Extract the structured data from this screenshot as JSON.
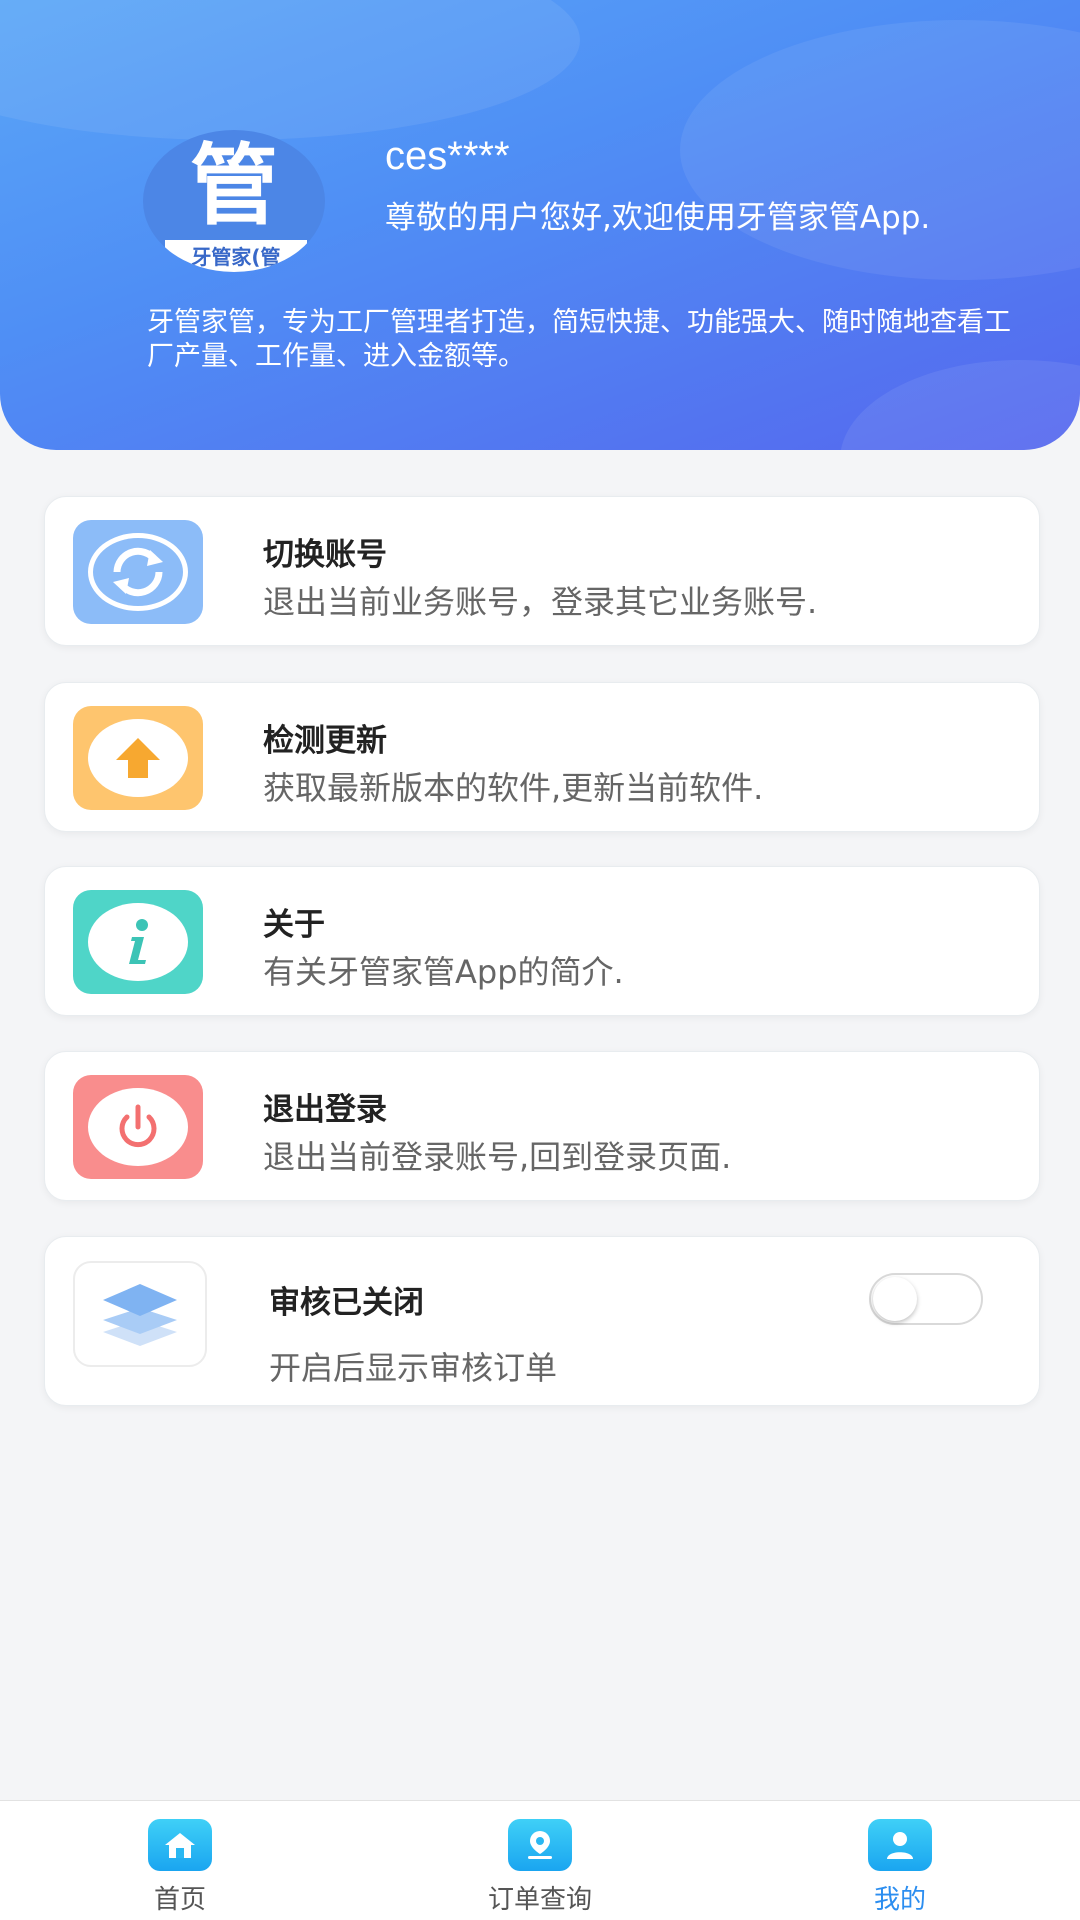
{
  "colors": {
    "header_start": "#5aa6f7",
    "header_end": "#5567ee",
    "switch_icon": "#8cbcf8",
    "update_icon": "#fec56e",
    "about_icon": "#4fd5c8",
    "logout_icon": "#f98d8d",
    "tab_active": "#2c8ef0"
  },
  "header": {
    "avatar_glyph": "管",
    "avatar_banner": "牙管家(管",
    "username": "ces****",
    "welcome": "尊敬的用户您好,欢迎使用牙管家管App.",
    "description": "牙管家管，专为工厂管理者打造，简短快捷、功能强大、随时随地查看工厂产量、工作量、进入金额等。"
  },
  "menu": [
    {
      "icon": "refresh-icon",
      "title": "切换账号",
      "subtitle": "退出当前业务账号，登录其它业务账号."
    },
    {
      "icon": "upload-arrow-icon",
      "title": "检测更新",
      "subtitle": "获取最新版本的软件,更新当前软件."
    },
    {
      "icon": "info-icon",
      "title": "关于",
      "subtitle": "有关牙管家管App的简介."
    },
    {
      "icon": "power-icon",
      "title": "退出登录",
      "subtitle": "退出当前登录账号,回到登录页面."
    }
  ],
  "review": {
    "icon": "layers-icon",
    "title": "审核已关闭",
    "subtitle": "开启后显示审核订单",
    "toggle_on": false
  },
  "tabbar": [
    {
      "icon": "home-icon",
      "label": "首页",
      "active": false
    },
    {
      "icon": "order-search-icon",
      "label": "订单查询",
      "active": false
    },
    {
      "icon": "user-icon",
      "label": "我的",
      "active": true
    }
  ]
}
